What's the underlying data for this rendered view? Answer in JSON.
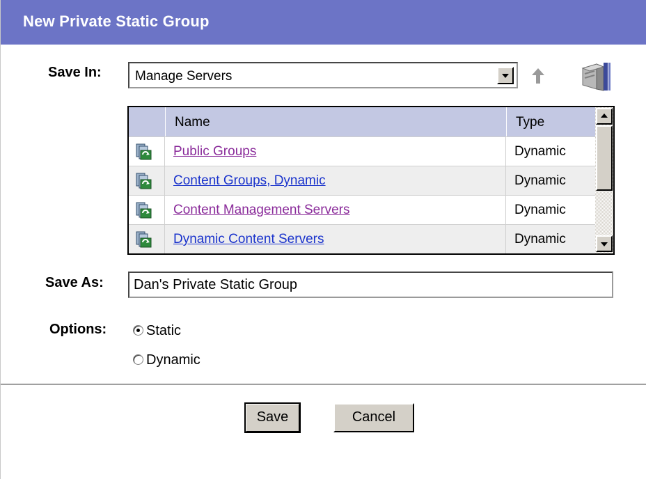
{
  "dialog": {
    "title": "New Private Static Group"
  },
  "save_in": {
    "label": "Save In:",
    "selected": "Manage Servers"
  },
  "table": {
    "columns": [
      "Name",
      "Type"
    ],
    "rows": [
      {
        "name": "Public Groups",
        "type": "Dynamic",
        "visited": true
      },
      {
        "name": "Content Groups, Dynamic",
        "type": "Dynamic",
        "visited": false
      },
      {
        "name": "Content Management Servers",
        "type": "Dynamic",
        "visited": true
      },
      {
        "name": "Dynamic Content Servers",
        "type": "Dynamic",
        "visited": false
      }
    ]
  },
  "save_as": {
    "label": "Save As:",
    "value": "Dan's Private Static Group"
  },
  "options": {
    "label": "Options:",
    "items": [
      {
        "label": "Static",
        "checked": true
      },
      {
        "label": "Dynamic",
        "checked": false
      }
    ]
  },
  "buttons": {
    "save": "Save",
    "cancel": "Cancel"
  },
  "icons": {
    "up": "up-arrow-icon",
    "server_browser": "server-group-icon",
    "row": "dynamic-group-icon"
  },
  "colors": {
    "title_bar": "#6c74c6",
    "table_header": "#c3c8e3",
    "link_visited": "#8a2b9a",
    "link_unvisited": "#1a33cc"
  }
}
